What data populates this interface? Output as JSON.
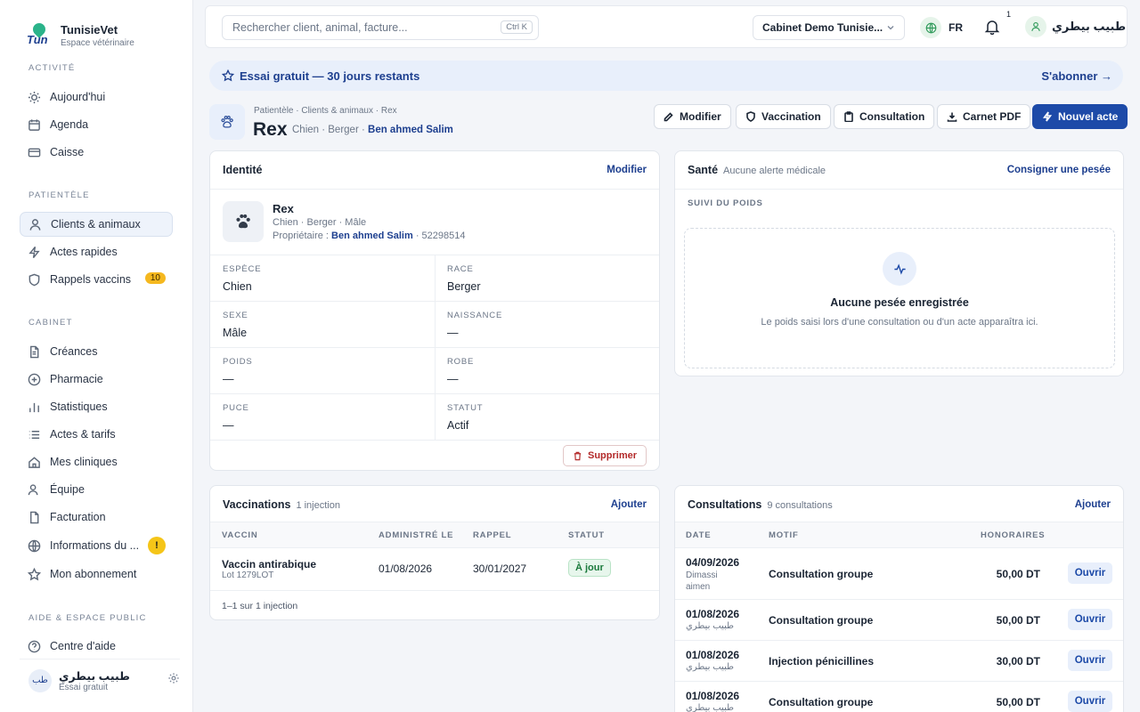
{
  "brand": {
    "name": "TunisieVet",
    "subtitle": "Espace vétérinaire",
    "logo_text": "Tun"
  },
  "sidebar": {
    "sections": {
      "activite": "ACTIVITÉ",
      "patientele": "PATIENTÈLE",
      "cabinet": "CABINET",
      "aide": "AIDE & ESPACE PUBLIC"
    },
    "items": [
      {
        "label": "Aujourd'hui",
        "icon": "sun-icon"
      },
      {
        "label": "Agenda",
        "icon": "calendar-icon"
      },
      {
        "label": "Caisse",
        "icon": "card-icon"
      },
      {
        "label": "Clients & animaux",
        "icon": "user-icon"
      },
      {
        "label": "Actes rapides",
        "icon": "bolt-icon"
      },
      {
        "label": "Rappels vaccins",
        "icon": "shield-icon",
        "badge": "10"
      },
      {
        "label": "Créances",
        "icon": "file-icon"
      },
      {
        "label": "Pharmacie",
        "icon": "plus-circle-icon"
      },
      {
        "label": "Statistiques",
        "icon": "bar-chart-icon"
      },
      {
        "label": "Actes & tarifs",
        "icon": "list-icon"
      },
      {
        "label": "Mes cliniques",
        "icon": "home-icon"
      },
      {
        "label": "Équipe",
        "icon": "team-icon"
      },
      {
        "label": "Facturation",
        "icon": "document-icon"
      },
      {
        "label": "Informations du ...",
        "icon": "globe-icon",
        "badge": "!"
      },
      {
        "label": "Mon abonnement",
        "icon": "star-icon"
      },
      {
        "label": "Centre d'aide",
        "icon": "help-icon"
      }
    ],
    "user": {
      "avatar": "طب",
      "name": "طبيب بيطري",
      "plan": "Essai gratuit"
    }
  },
  "topbar": {
    "search_placeholder": "Rechercher client, animal, facture...",
    "shortcut": "Ctrl K",
    "cabinet": "Cabinet Demo Tunisie...",
    "lang": "FR",
    "notif_count": "1",
    "profile_name": "طبيب بيطري"
  },
  "trial": {
    "text": "Essai gratuit — 30 jours restants",
    "cta": "S'abonner →"
  },
  "patient": {
    "breadcrumb": "Patientèle · Clients & animaux · Rex",
    "name": "Rex",
    "meta": "Chien · Berger ·",
    "owner": "Ben ahmed Salim"
  },
  "actions": {
    "modifier": "Modifier",
    "vaccination": "Vaccination",
    "consultation": "Consultation",
    "carnet": "Carnet PDF",
    "nouvel": "Nouvel acte"
  },
  "identite": {
    "title": "Identité",
    "edit": "Modifier",
    "name": "Rex",
    "sub": "Chien · Berger · Mâle",
    "owner_label": "Propriétaire :",
    "owner": "Ben ahmed Salim",
    "phone": "· 52298514",
    "fields": {
      "espece_l": "ESPÈCE",
      "espece_v": "Chien",
      "race_l": "RACE",
      "race_v": "Berger",
      "sexe_l": "SEXE",
      "sexe_v": "Mâle",
      "naissance_l": "NAISSANCE",
      "naissance_v": "—",
      "poids_l": "POIDS",
      "poids_v": "—",
      "robe_l": "ROBE",
      "robe_v": "—",
      "puce_l": "PUCE",
      "puce_v": "—",
      "statut_l": "STATUT",
      "statut_v": "Actif"
    },
    "delete": "Supprimer"
  },
  "sante": {
    "title": "Santé",
    "alert": "Aucune alerte médicale",
    "link": "Consigner une pesée",
    "section": "SUIVI DU POIDS",
    "empty_title": "Aucune pesée enregistrée",
    "empty_desc": "Le poids saisi lors d'une consultation ou d'un acte apparaîtra ici."
  },
  "vaccinations": {
    "title": "Vaccinations",
    "count": "1 injection",
    "add": "Ajouter",
    "headers": {
      "vaccin": "VACCIN",
      "admin": "ADMINISTRÉ LE",
      "rappel": "RAPPEL",
      "statut": "STATUT"
    },
    "rows": [
      {
        "name": "Vaccin antirabique",
        "lot": "Lot 1279LOT",
        "admin": "01/08/2026",
        "rappel": "30/01/2027",
        "statut": "À jour"
      }
    ],
    "footer": "1–1 sur 1 injection"
  },
  "consultations": {
    "title": "Consultations",
    "count": "9 consultations",
    "add": "Ajouter",
    "headers": {
      "date": "DATE",
      "motif": "MOTIF",
      "honoraires": "HONORAIRES"
    },
    "open_label": "Ouvrir",
    "rows": [
      {
        "date": "04/09/2026",
        "by": "Dimassi aimen",
        "motif": "Consultation groupe",
        "fee": "50,00 DT"
      },
      {
        "date": "01/08/2026",
        "by": "طبيب بيطري",
        "motif": "Consultation groupe",
        "fee": "50,00 DT"
      },
      {
        "date": "01/08/2026",
        "by": "طبيب بيطري",
        "motif": "Injection pénicillines",
        "fee": "30,00 DT"
      },
      {
        "date": "01/08/2026",
        "by": "طبيب بيطري",
        "motif": "Consultation groupe",
        "fee": "50,00 DT"
      }
    ]
  }
}
